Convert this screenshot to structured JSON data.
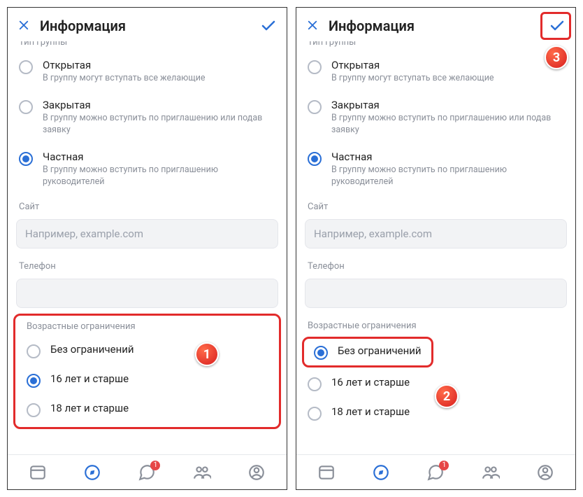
{
  "header": {
    "title": "Информация"
  },
  "group_type": {
    "label": "Тип группы",
    "options": [
      {
        "title": "Открытая",
        "desc": "В группу могут вступать все желающие"
      },
      {
        "title": "Закрытая",
        "desc": "В группу можно вступить по приглашению или подав заявку"
      },
      {
        "title": "Частная",
        "desc": "В группу можно вступить по приглашению руководителей"
      }
    ],
    "selected_index": 2
  },
  "site": {
    "label": "Сайт",
    "placeholder": "Например, example.com"
  },
  "phone_section": {
    "label": "Телефон",
    "value": ""
  },
  "age": {
    "label": "Возрастные ограничения",
    "options": [
      "Без ограничений",
      "16 лет и старше",
      "18 лет и старше"
    ]
  },
  "left_age_selected_index": 1,
  "right_age_selected_index": 0,
  "nav": {
    "badge_count": "1"
  },
  "steps": {
    "one": "1",
    "two": "2",
    "three": "3"
  }
}
